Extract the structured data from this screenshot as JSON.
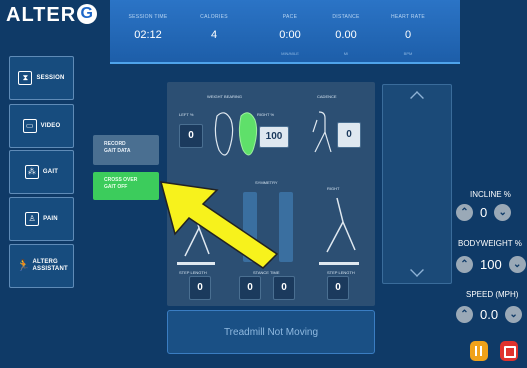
{
  "brand": {
    "logo": "ALTER",
    "logo_mark": "G"
  },
  "stats": [
    {
      "label": "SESSION TIME",
      "value": "02:12",
      "unit": ""
    },
    {
      "label": "CALORIES",
      "value": "4",
      "unit": ""
    },
    {
      "label": "PACE",
      "value": "0:00",
      "unit": "MIN/MILE"
    },
    {
      "label": "DISTANCE",
      "value": "0.00",
      "unit": "MI"
    },
    {
      "label": "HEART RATE",
      "value": "0",
      "unit": "BPM"
    }
  ],
  "menu": [
    {
      "label": "SESSION",
      "icon": "hourglass-icon"
    },
    {
      "label": "VIDEO",
      "icon": "monitor-icon"
    },
    {
      "label": "GAIT",
      "icon": "footprint-icon"
    },
    {
      "label": "PAIN",
      "icon": "person-icon"
    },
    {
      "label": "ALTERG ASSISTANT",
      "icon": "runner-icon"
    }
  ],
  "record_btn": {
    "line1": "RECORD",
    "line2": "GAIT DATA"
  },
  "crossover_btn": {
    "line1": "CROSS OVER",
    "line2": "GAIT OFF"
  },
  "panel": {
    "weight_bearing": "WEIGHT BEARING",
    "cadence": "CADENCE",
    "left_pct_label": "LEFT %",
    "left_pct": "0",
    "right_pct_label": "RIGHT %",
    "right_pct": "100",
    "cadence_value": "0",
    "symmetry": "SYMMETRY",
    "right_label": "RIGHT",
    "step_length_label": "STEP LENGTH",
    "stance_time_label": "STANCE TIME",
    "step_length_left": "0",
    "stance_left": "0",
    "stance_right": "0",
    "step_length_right": "0"
  },
  "status_text": "Treadmill Not Moving",
  "controls": {
    "incline_label": "INCLINE %",
    "incline": "0",
    "bodyweight_label": "BODYWEIGHT %",
    "bodyweight": "100",
    "speed_label": "SPEED (MPH)",
    "speed": "0.0"
  },
  "colors": {
    "accent_green": "#3ccc5c",
    "pause": "#f0a21a",
    "stop": "#e0322d",
    "arrow": "#f7f21c"
  }
}
